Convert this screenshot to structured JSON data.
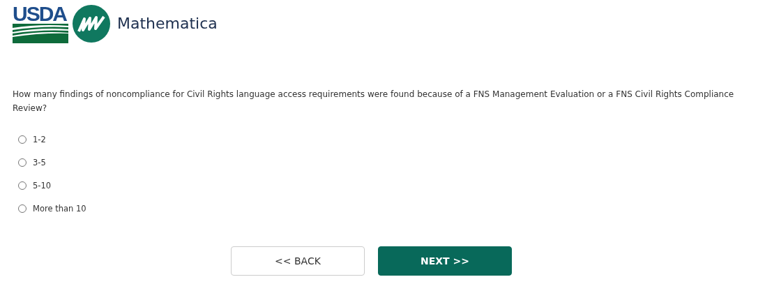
{
  "logos": {
    "usda": "USDA",
    "mathematica": "Mathematica"
  },
  "question": {
    "text": "How many findings of noncompliance for Civil Rights language access requirements were found because of a FNS Management Evaluation or a FNS Civil Rights Compliance Review?",
    "options": [
      {
        "label": "1-2",
        "selected": false
      },
      {
        "label": "3-5",
        "selected": false
      },
      {
        "label": "5-10",
        "selected": false
      },
      {
        "label": "More than 10",
        "selected": false
      }
    ]
  },
  "buttons": [
    {
      "kind": "secondary",
      "label": "<< BACK"
    },
    {
      "kind": "primary",
      "label": "NEXT >>"
    }
  ]
}
